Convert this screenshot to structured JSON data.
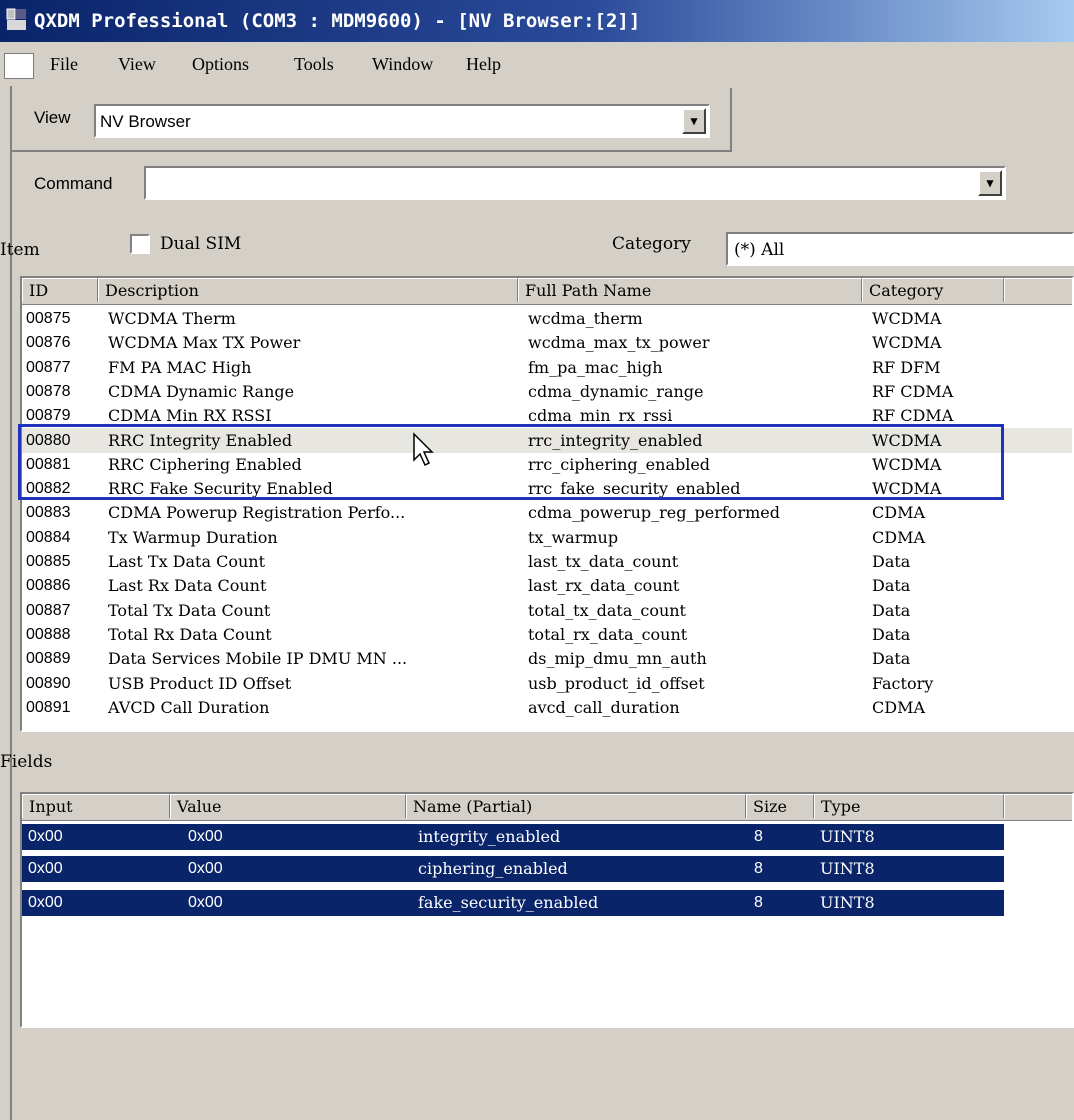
{
  "window": {
    "title": "QXDM Professional (COM3 : MDM9600) - [NV Browser:[2]]"
  },
  "menu": [
    "File",
    "View",
    "Options",
    "Tools",
    "Window",
    "Help"
  ],
  "view_label": "View",
  "view_value": "NV Browser",
  "command_label": "Command",
  "command_value": "",
  "item_label": "Item",
  "dual_sim_label": "Dual SIM",
  "dual_sim_checked": false,
  "category_label": "Category",
  "category_value": "(*) All",
  "items_table": {
    "columns": [
      "ID",
      "Description",
      "Full Path Name",
      "Category"
    ],
    "rows": [
      {
        "id": "00875",
        "desc": "WCDMA Therm",
        "path": "wcdma_therm",
        "cat": "WCDMA"
      },
      {
        "id": "00876",
        "desc": "WCDMA Max TX Power",
        "path": "wcdma_max_tx_power",
        "cat": "WCDMA"
      },
      {
        "id": "00877",
        "desc": "FM PA MAC High",
        "path": "fm_pa_mac_high",
        "cat": "RF DFM"
      },
      {
        "id": "00878",
        "desc": "CDMA Dynamic Range",
        "path": "cdma_dynamic_range",
        "cat": "RF CDMA"
      },
      {
        "id": "00879",
        "desc": "CDMA Min RX RSSI",
        "path": "cdma_min_rx_rssi",
        "cat": "RF CDMA"
      },
      {
        "id": "00880",
        "desc": "RRC Integrity Enabled",
        "path": "rrc_integrity_enabled",
        "cat": "WCDMA",
        "selected": true
      },
      {
        "id": "00881",
        "desc": "RRC Ciphering Enabled",
        "path": "rrc_ciphering_enabled",
        "cat": "WCDMA"
      },
      {
        "id": "00882",
        "desc": "RRC Fake Security Enabled",
        "path": "rrc_fake_security_enabled",
        "cat": "WCDMA"
      },
      {
        "id": "00883",
        "desc": "CDMA Powerup Registration Perfo...",
        "path": "cdma_powerup_reg_performed",
        "cat": "CDMA"
      },
      {
        "id": "00884",
        "desc": "Tx Warmup Duration",
        "path": "tx_warmup",
        "cat": "CDMA"
      },
      {
        "id": "00885",
        "desc": "Last Tx Data Count",
        "path": "last_tx_data_count",
        "cat": "Data"
      },
      {
        "id": "00886",
        "desc": "Last Rx Data Count",
        "path": "last_rx_data_count",
        "cat": "Data"
      },
      {
        "id": "00887",
        "desc": "Total Tx Data Count",
        "path": "total_tx_data_count",
        "cat": "Data"
      },
      {
        "id": "00888",
        "desc": "Total Rx Data Count",
        "path": "total_rx_data_count",
        "cat": "Data"
      },
      {
        "id": "00889",
        "desc": "Data Services Mobile IP DMU MN ...",
        "path": "ds_mip_dmu_mn_auth",
        "cat": "Data"
      },
      {
        "id": "00890",
        "desc": "USB Product ID Offset",
        "path": "usb_product_id_offset",
        "cat": "Factory"
      },
      {
        "id": "00891",
        "desc": "AVCD Call Duration",
        "path": "avcd_call_duration",
        "cat": "CDMA"
      }
    ]
  },
  "fields_label": "Fields",
  "fields_table": {
    "columns": [
      "Input",
      "Value",
      "Name (Partial)",
      "Size",
      "Type"
    ],
    "rows": [
      {
        "input": "0x00",
        "value": "0x00",
        "name": "integrity_enabled",
        "size": "8",
        "type": "UINT8"
      },
      {
        "input": "0x00",
        "value": "0x00",
        "name": "ciphering_enabled",
        "size": "8",
        "type": "UINT8"
      },
      {
        "input": "0x00",
        "value": "0x00",
        "name": "fake_security_enabled",
        "size": "8",
        "type": "UINT8"
      }
    ]
  },
  "highlight_color": "#2233bb",
  "selection_color": "#0a246a"
}
